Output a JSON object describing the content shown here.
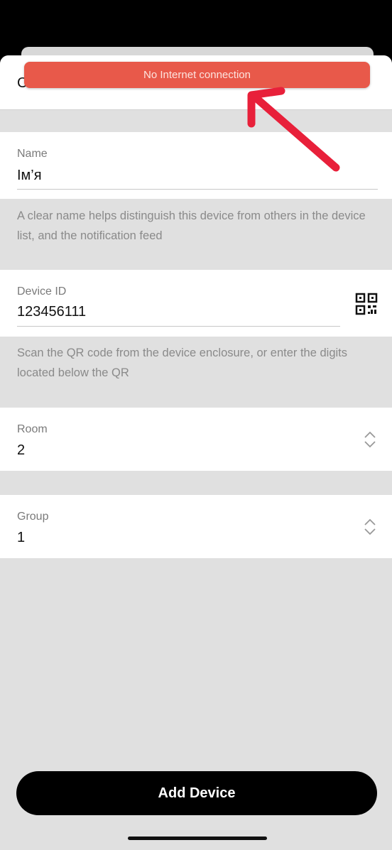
{
  "header": {
    "title": "C"
  },
  "toast": {
    "text": "No Internet connection"
  },
  "name_field": {
    "label": "Name",
    "value": "Ім’я",
    "hint": "A clear name helps distinguish this device from others in the device list, and the notification feed"
  },
  "device_id_field": {
    "label": "Device ID",
    "value": "123456111",
    "hint": "Scan the QR code from the device enclosure, or enter the digits located below the QR",
    "icon": "qr-code-icon"
  },
  "room_field": {
    "label": "Room",
    "value": "2",
    "icon": "chevron-up-down-icon"
  },
  "group_field": {
    "label": "Group",
    "value": "1",
    "icon": "chevron-up-down-icon"
  },
  "actions": {
    "add_label": "Add Device"
  },
  "colors": {
    "toast_bg": "#e8594a",
    "annotation_arrow": "#e8203a",
    "button_bg": "#000000"
  }
}
